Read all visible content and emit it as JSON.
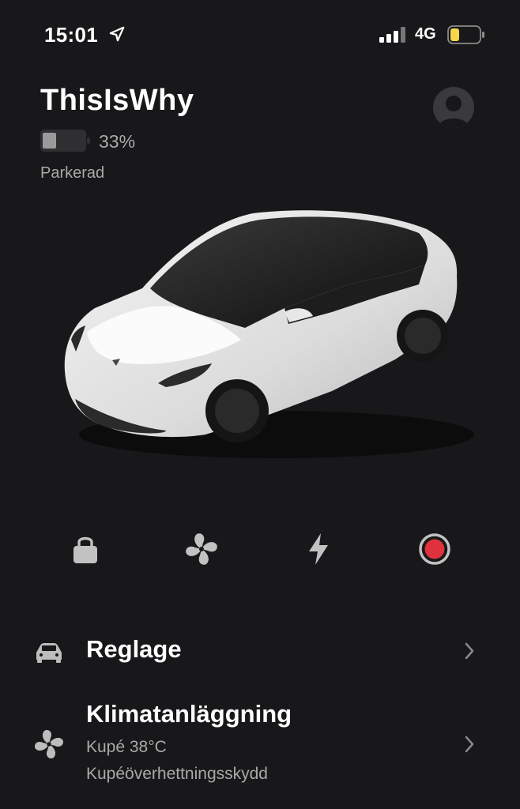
{
  "status_bar": {
    "time": "15:01",
    "network": "4G",
    "battery_color": "#f5d64b"
  },
  "vehicle": {
    "name": "ThisIsWhy",
    "battery_percent": "33%",
    "battery_level": 0.33,
    "state": "Parkerad"
  },
  "quick_actions": [
    {
      "icon": "lock-icon"
    },
    {
      "icon": "fan-icon"
    },
    {
      "icon": "bolt-icon"
    },
    {
      "icon": "record-icon",
      "color": "#e0323c"
    }
  ],
  "menu": {
    "controls": {
      "label": "Reglage"
    },
    "climate": {
      "label": "Klimatanläggning",
      "sub1": "Kupé 38°C",
      "sub2": "Kupéöverhettningsskydd"
    }
  }
}
